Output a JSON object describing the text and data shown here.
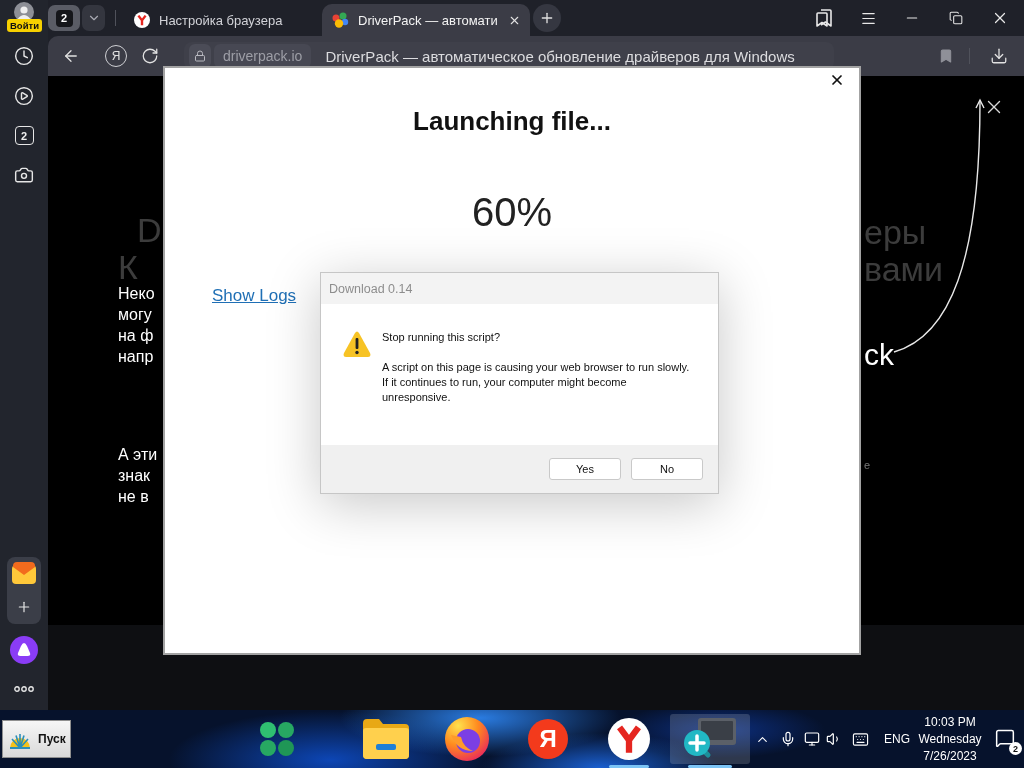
{
  "sidebar": {
    "login_badge": "Войти",
    "tab_groups_count": "2"
  },
  "tab_strip": {
    "tab_count": "2",
    "tabs": [
      {
        "title": "Настройка браузера",
        "kind": "yandex_browser",
        "selected": false
      },
      {
        "title": "DriverPack — автомати",
        "kind": "driverpack",
        "selected": true
      }
    ]
  },
  "toolbar": {
    "home_button": "Я",
    "host": "driverpack.io",
    "page_title": "DriverPack — автоматическое обновление драйверов для Windows"
  },
  "page": {
    "heading_left": [
      "D",
      "К"
    ],
    "heading_right": [
      "еры",
      "вами"
    ],
    "paragraphs": [
      [
        "Неко",
        "могу",
        "на ф",
        "напр"
      ],
      [
        "А эти",
        "знак",
        "не в"
      ]
    ],
    "brand_fragment": "ck",
    "footnote_fragment": "e"
  },
  "launcher": {
    "title": "Launching file...",
    "progress": "60%",
    "show_logs": "Show Logs"
  },
  "dialog": {
    "title": "Download 0.14",
    "heading": "Stop running this script?",
    "message": "A script on this page is causing your web browser to run slowly. If it continues to run, your computer might become unresponsive.",
    "buttons": [
      "Yes",
      "No"
    ]
  },
  "taskbar": {
    "start_label": "Пуск",
    "apps": [
      {
        "kind": "folder",
        "running": false,
        "active": false
      },
      {
        "kind": "firefox",
        "running": false,
        "active": false
      },
      {
        "kind": "yandex",
        "label": "Я",
        "running": false,
        "active": false
      },
      {
        "kind": "yandex_browser",
        "running": true,
        "active": false
      },
      {
        "kind": "magnifier",
        "running": true,
        "active": true
      }
    ],
    "language": "ENG",
    "time": "10:03 PM",
    "weekday": "Wednesday",
    "date": "7/26/2023",
    "notifications": "2"
  }
}
